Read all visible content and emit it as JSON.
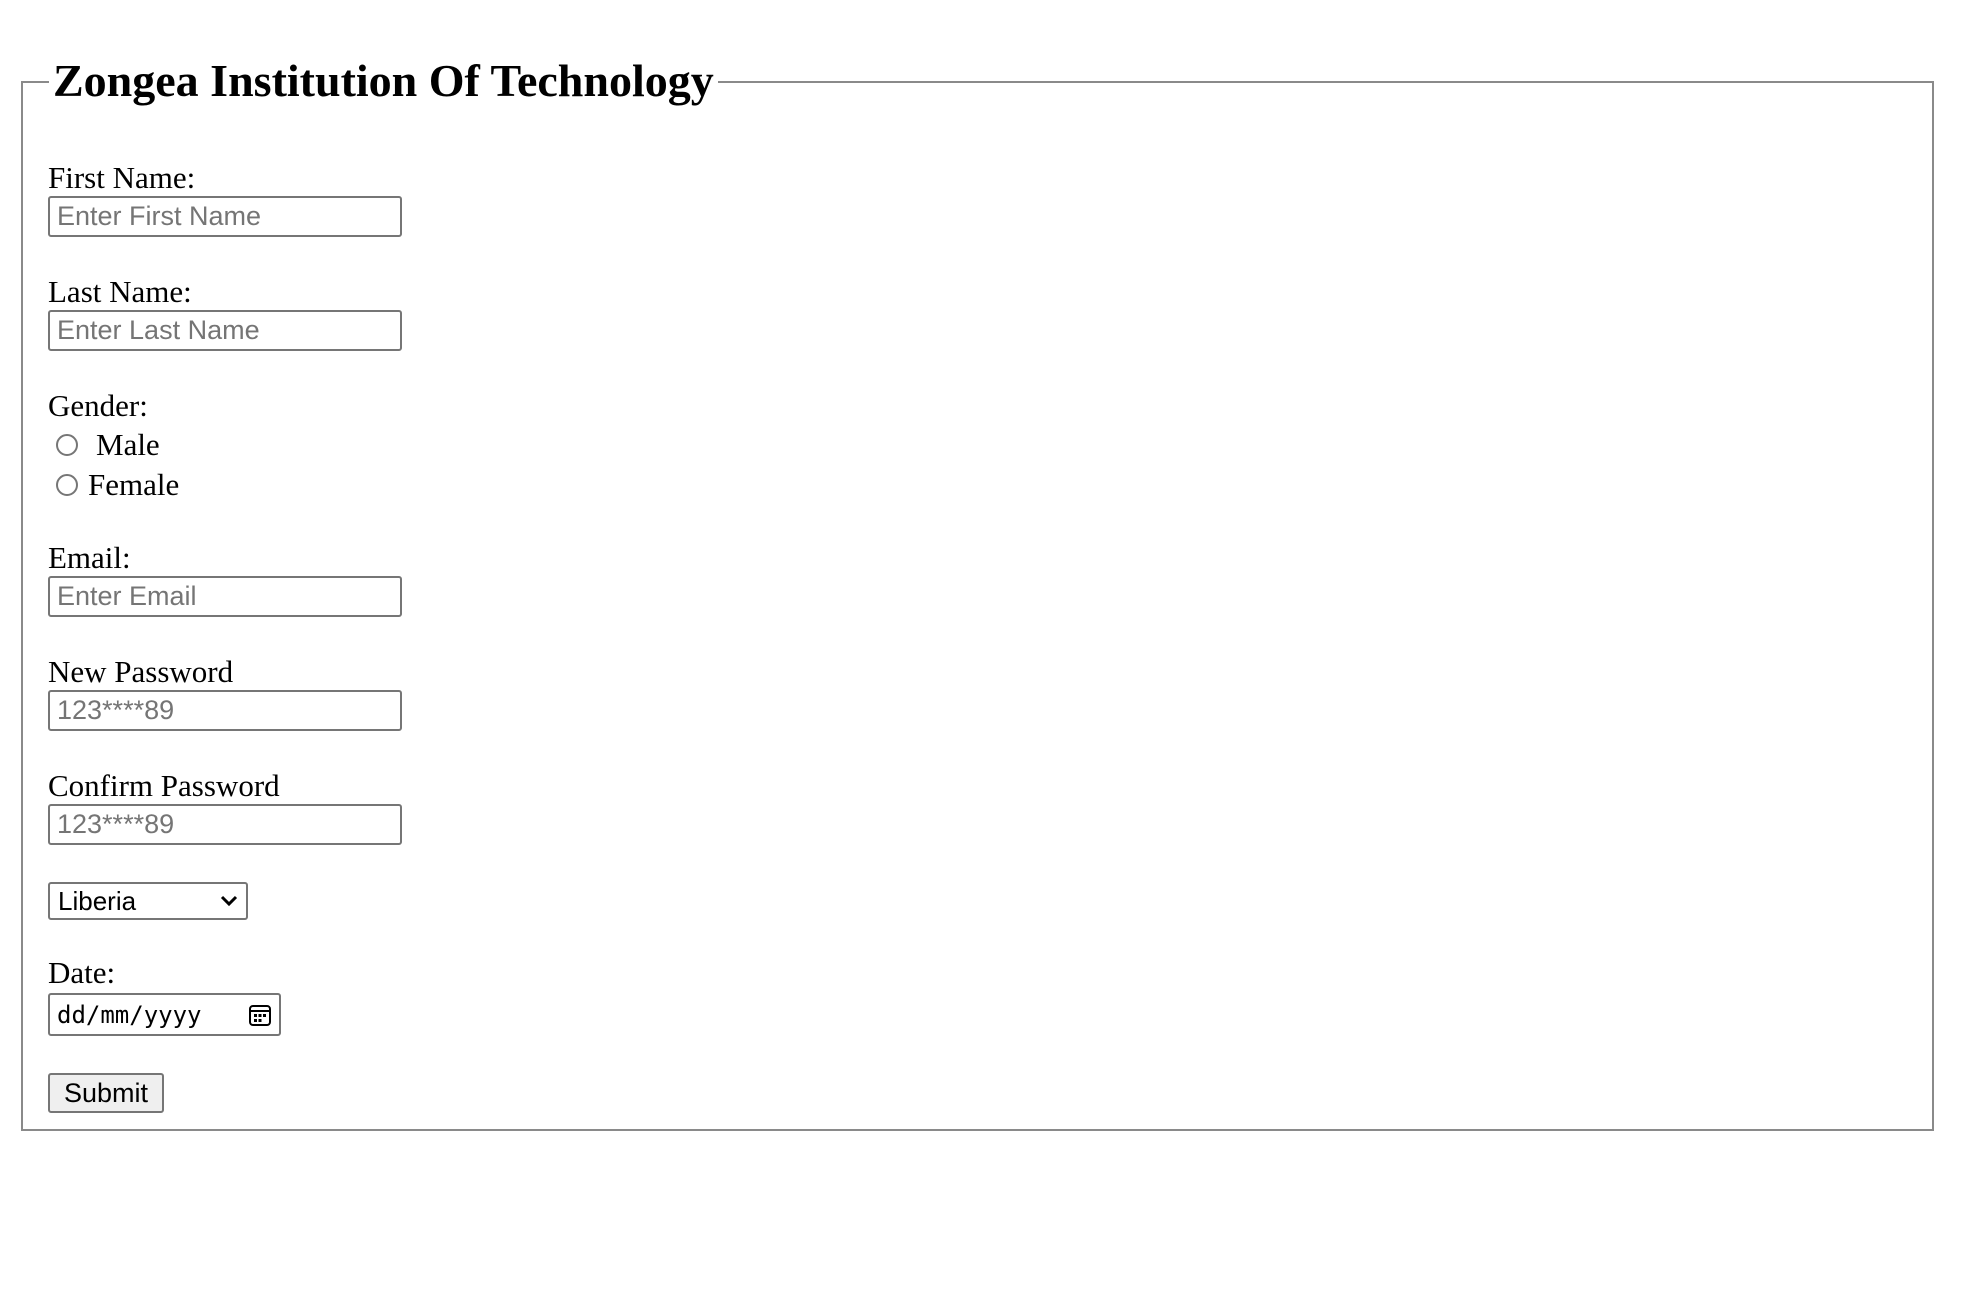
{
  "form": {
    "title": "Zongea Institution Of Technology",
    "first_name": {
      "label": "First Name:",
      "placeholder": "Enter First Name",
      "value": ""
    },
    "last_name": {
      "label": "Last Name:",
      "placeholder": "Enter Last Name",
      "value": ""
    },
    "gender": {
      "label": "Gender:",
      "options": [
        "Male",
        "Female"
      ]
    },
    "email": {
      "label": "Email:",
      "placeholder": "Enter Email",
      "value": ""
    },
    "new_password": {
      "label": "New Password",
      "placeholder": "123****89",
      "value": ""
    },
    "confirm_password": {
      "label": "Confirm Password",
      "placeholder": "123****89",
      "value": ""
    },
    "country": {
      "selected": "Liberia"
    },
    "date": {
      "label": "Date:",
      "placeholder": "dd/mm/yyyy"
    },
    "submit_label": "Submit"
  }
}
